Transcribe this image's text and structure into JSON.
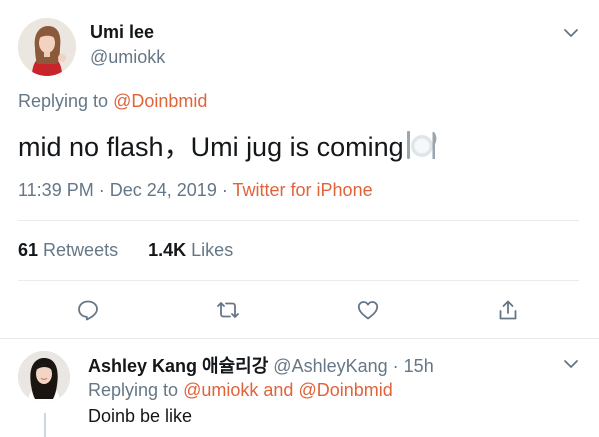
{
  "main_tweet": {
    "display_name": "Umi lee",
    "handle": "@umiokk",
    "replying_prefix": "Replying to",
    "replying_to": "@Doinbmid",
    "text": "mid no flash，Umi jug is coming",
    "emoji_icon": "fork-knife-plate-icon",
    "time": "11:39 PM",
    "date": "Dec 24, 2019",
    "source": "Twitter for iPhone",
    "separator": "·",
    "retweets_count": "61",
    "retweets_label": "Retweets",
    "likes_count": "1.4K",
    "likes_label": "Likes"
  },
  "actions": {
    "reply_icon": "reply-icon",
    "retweet_icon": "retweet-icon",
    "like_icon": "heart-icon",
    "share_icon": "share-icon"
  },
  "reply_tweet": {
    "display_name": "Ashley Kang 애슐리강",
    "handle": "@AshleyKang",
    "separator": "·",
    "time_ago": "15h",
    "replying_prefix": "Replying to",
    "replying_to_1": "@umiokk",
    "conjunction": "and",
    "replying_to_2": "@Doinbmid",
    "text": "Doinb be like"
  },
  "colors": {
    "link": "#e0633a",
    "secondary_text": "#657786",
    "primary_text": "#14171a",
    "divider": "#e6ecf0"
  }
}
